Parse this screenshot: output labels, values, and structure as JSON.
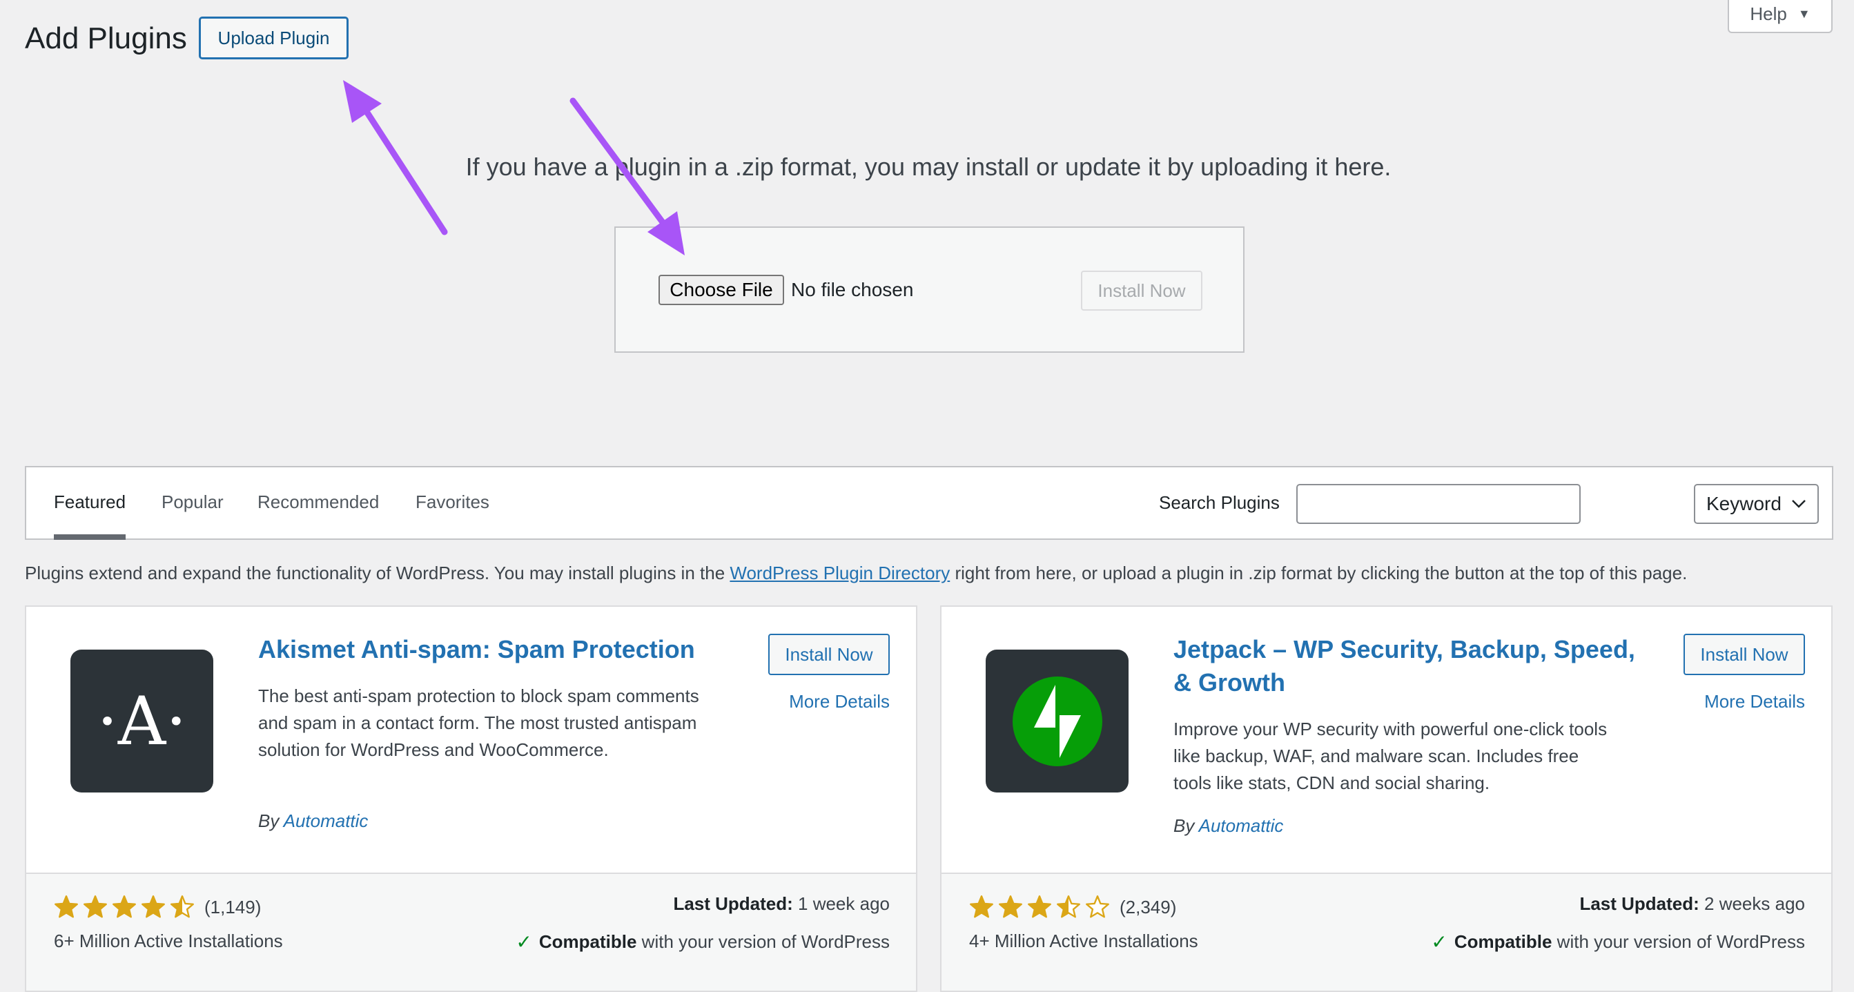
{
  "header": {
    "title": "Add Plugins",
    "upload_button": "Upload Plugin",
    "help": "Help"
  },
  "upload": {
    "message": "If you have a plugin in a .zip format, you may install or update it by uploading it here.",
    "choose_file": "Choose File",
    "no_file": "No file chosen",
    "install_now": "Install Now"
  },
  "filter": {
    "tabs": [
      "Featured",
      "Popular",
      "Recommended",
      "Favorites"
    ],
    "active_tab": "Featured",
    "search_label": "Search Plugins",
    "search_value": "",
    "search_type": "Keyword"
  },
  "intro": {
    "before": "Plugins extend and expand the functionality of WordPress. You may install plugins in the ",
    "link": "WordPress Plugin Directory",
    "after": " right from here, or upload a plugin in .zip format by clicking the button at the top of this page."
  },
  "plugins": [
    {
      "title": "Akismet Anti-spam: Spam Protection",
      "description": "The best anti-spam protection to block spam comments and spam in a contact form. The most trusted antispam solution for WordPress and WooCommerce.",
      "by": "By",
      "author": "Automattic",
      "install": "Install Now",
      "more": "More Details",
      "rating": 4.5,
      "rating_count": "(1,149)",
      "installs": "6+ Million Active Installations",
      "last_updated_label": "Last Updated:",
      "last_updated": "1 week ago",
      "compatible_label": "Compatible",
      "compatible_text": "with your version of WordPress",
      "icon_letter": "·A·"
    },
    {
      "title": "Jetpack – WP Security, Backup, Speed, & Growth",
      "description": "Improve your WP security with powerful one-click tools like backup, WAF, and malware scan. Includes free tools like stats, CDN and social sharing.",
      "by": "By",
      "author": "Automattic",
      "install": "Install Now",
      "more": "More Details",
      "rating": 3.5,
      "rating_count": "(2,349)",
      "installs": "4+ Million Active Installations",
      "last_updated_label": "Last Updated:",
      "last_updated": "2 weeks ago",
      "compatible_label": "Compatible",
      "compatible_text": "with your version of WordPress"
    }
  ],
  "colors": {
    "accent": "#2271b1",
    "star": "#dba617",
    "jetpack_green": "#069e08",
    "annotation_arrow": "#a855f7"
  }
}
